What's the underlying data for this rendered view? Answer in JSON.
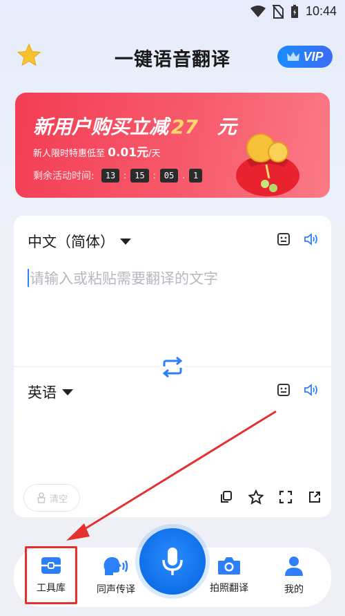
{
  "status_bar": {
    "time": "10:44"
  },
  "header": {
    "title": "一键语音翻译",
    "vip_label": "VIP"
  },
  "promo": {
    "title_prefix": "新用户购买立减",
    "amount": "27",
    "title_suffix": "元",
    "subtitle_prefix": "新人限时特惠低至",
    "price": "0.01元",
    "subtitle_suffix": "/天",
    "countdown_label": "剩余活动时间:",
    "countdown": [
      "13",
      "15",
      "05",
      "1"
    ]
  },
  "translator": {
    "source_lang": "中文（简体）",
    "input_placeholder": "请输入或粘贴需要翻译的文字",
    "target_lang": "英语",
    "clear_label": "清空"
  },
  "bottom_nav": {
    "items": [
      {
        "label": "工具库",
        "icon": "toolbox-icon"
      },
      {
        "label": "同声传译",
        "icon": "speech-head-icon"
      },
      {
        "label": "拍照翻译",
        "icon": "camera-icon"
      },
      {
        "label": "我的",
        "icon": "user-icon"
      }
    ]
  },
  "colors": {
    "accent": "#2d7ff9",
    "promo_red": "#f33d54",
    "highlight_red": "#e63030"
  }
}
